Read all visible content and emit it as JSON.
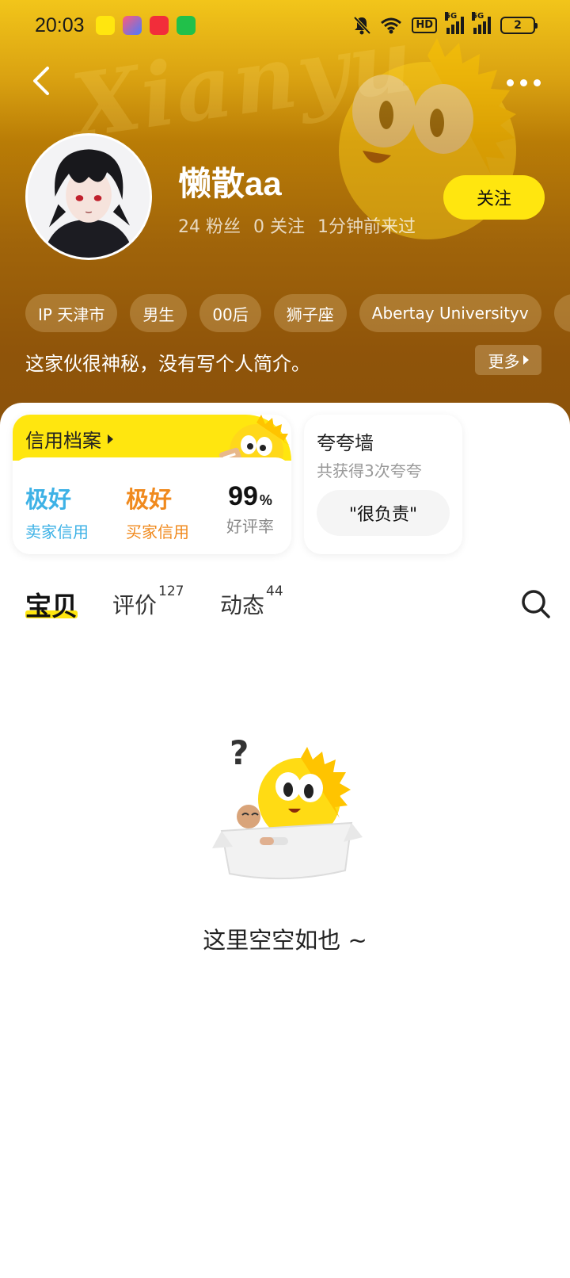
{
  "status_bar": {
    "time": "20:03",
    "network_1": "5G",
    "network_2": "5G",
    "hd": "HD",
    "battery": "2"
  },
  "header": {
    "bg_script_text": "Xianyu",
    "username": "懒散aa",
    "fans": "24 粉丝",
    "following": "0 关注",
    "last_seen": "1分钟前来过",
    "follow_label": "关注"
  },
  "tags": [
    "IP 天津市",
    "男生",
    "00后",
    "狮子座",
    "Abertay Universityv"
  ],
  "bio": {
    "text": "这家伙很神秘，没有写个人简介。",
    "more_label": "更多"
  },
  "credit": {
    "title": "信用档案",
    "seller_value": "极好",
    "seller_label": "卖家信用",
    "buyer_value": "极好",
    "buyer_label": "买家信用",
    "rating_value": "99",
    "rating_unit": "%",
    "rating_label": "好评率"
  },
  "praise": {
    "title": "夸夸墙",
    "subtitle": "共获得3次夸夸",
    "chip": "\"很负责\""
  },
  "tabs": [
    {
      "label": "宝贝",
      "count": ""
    },
    {
      "label": "评价",
      "count": "127"
    },
    {
      "label": "动态",
      "count": "44"
    }
  ],
  "empty": {
    "text": "这里空空如也 ~"
  },
  "colors": {
    "accent_yellow": "#ffe60f",
    "seller_blue": "#3eb2e6",
    "buyer_orange": "#f08a1e",
    "header_brown": "#a0640a"
  },
  "icons": [
    "back-arrow-icon",
    "more-dots-icon",
    "search-icon",
    "triangle-right-icon"
  ]
}
